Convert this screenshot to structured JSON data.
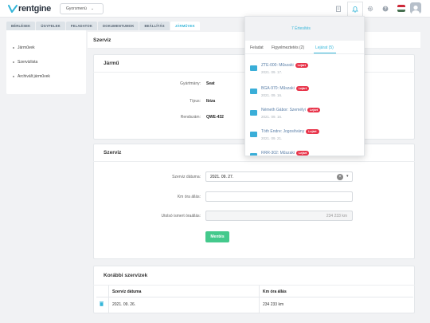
{
  "header": {
    "logo_text": "rentgine",
    "quick_menu": "Gyorsmenü",
    "icons": [
      "clipboard-icon",
      "bell-icon",
      "gear-icon",
      "help-icon"
    ],
    "flag_colors": [
      "#ce2939",
      "#ffffff",
      "#477050"
    ],
    "brand_color": "#35b6d9"
  },
  "tabs": [
    {
      "label": "BÉRLÉSEK",
      "active": false
    },
    {
      "label": "ÜGYFELEK",
      "active": false
    },
    {
      "label": "FELADATOK",
      "active": false
    },
    {
      "label": "DOKUMENTUMOK",
      "active": false
    },
    {
      "label": "BEÁLLÍTÁS",
      "active": false
    },
    {
      "label": "JÁRMŰVEK",
      "active": true
    }
  ],
  "sidebar": {
    "items": [
      {
        "label": "Járművek"
      },
      {
        "label": "Szervizlista"
      },
      {
        "label": "Archivált járművek"
      }
    ]
  },
  "page": {
    "title": "Szerviz"
  },
  "vehicle": {
    "title": "Jármű",
    "fields": [
      {
        "label": "Gyártmány:",
        "value": "Seat"
      },
      {
        "label": "Típus:",
        "value": "Ibiza"
      },
      {
        "label": "Rendszám:",
        "value": "QWE-432"
      }
    ]
  },
  "service": {
    "title": "Szerviz",
    "date_label": "Szerviz dátuma:",
    "date_value": "2021. 09. 27.",
    "km_label": "Km óra állás:",
    "km_value": "",
    "last_km_label": "Utolsó ismert óraállás:",
    "last_km_value": "234 233 km",
    "save_button": "Mentés"
  },
  "previous": {
    "title": "Korábbi szervizek",
    "columns": [
      "Szerviz dátuma",
      "Km óra állás"
    ],
    "rows": [
      {
        "date": "2021. 09. 26.",
        "km": "234 233 km"
      }
    ]
  },
  "notifications": {
    "header": "7 Értesítés",
    "tabs": [
      {
        "label": "Feladat",
        "active": false
      },
      {
        "label": "Figyelmeztetés (2)",
        "active": false
      },
      {
        "label": "Lejárat (5)",
        "active": true
      }
    ],
    "items": [
      {
        "title": "ZTE-000: Műszaki",
        "badge": "Lejárt",
        "date": "2021. 09. 17."
      },
      {
        "title": "BGA-970: Műszaki",
        "badge": "Lejárt",
        "date": "2021. 09. 16."
      },
      {
        "title": "Németh Gábor: Személyi",
        "badge": "Lejárt",
        "date": "2021. 09. 16."
      },
      {
        "title": "Tóth Endre: Jogosítvány",
        "badge": "Lejárt",
        "date": "2021. 09. 21."
      },
      {
        "title": "RRR-302: Műszaki",
        "badge": "Lejárt",
        "date": ""
      }
    ]
  }
}
